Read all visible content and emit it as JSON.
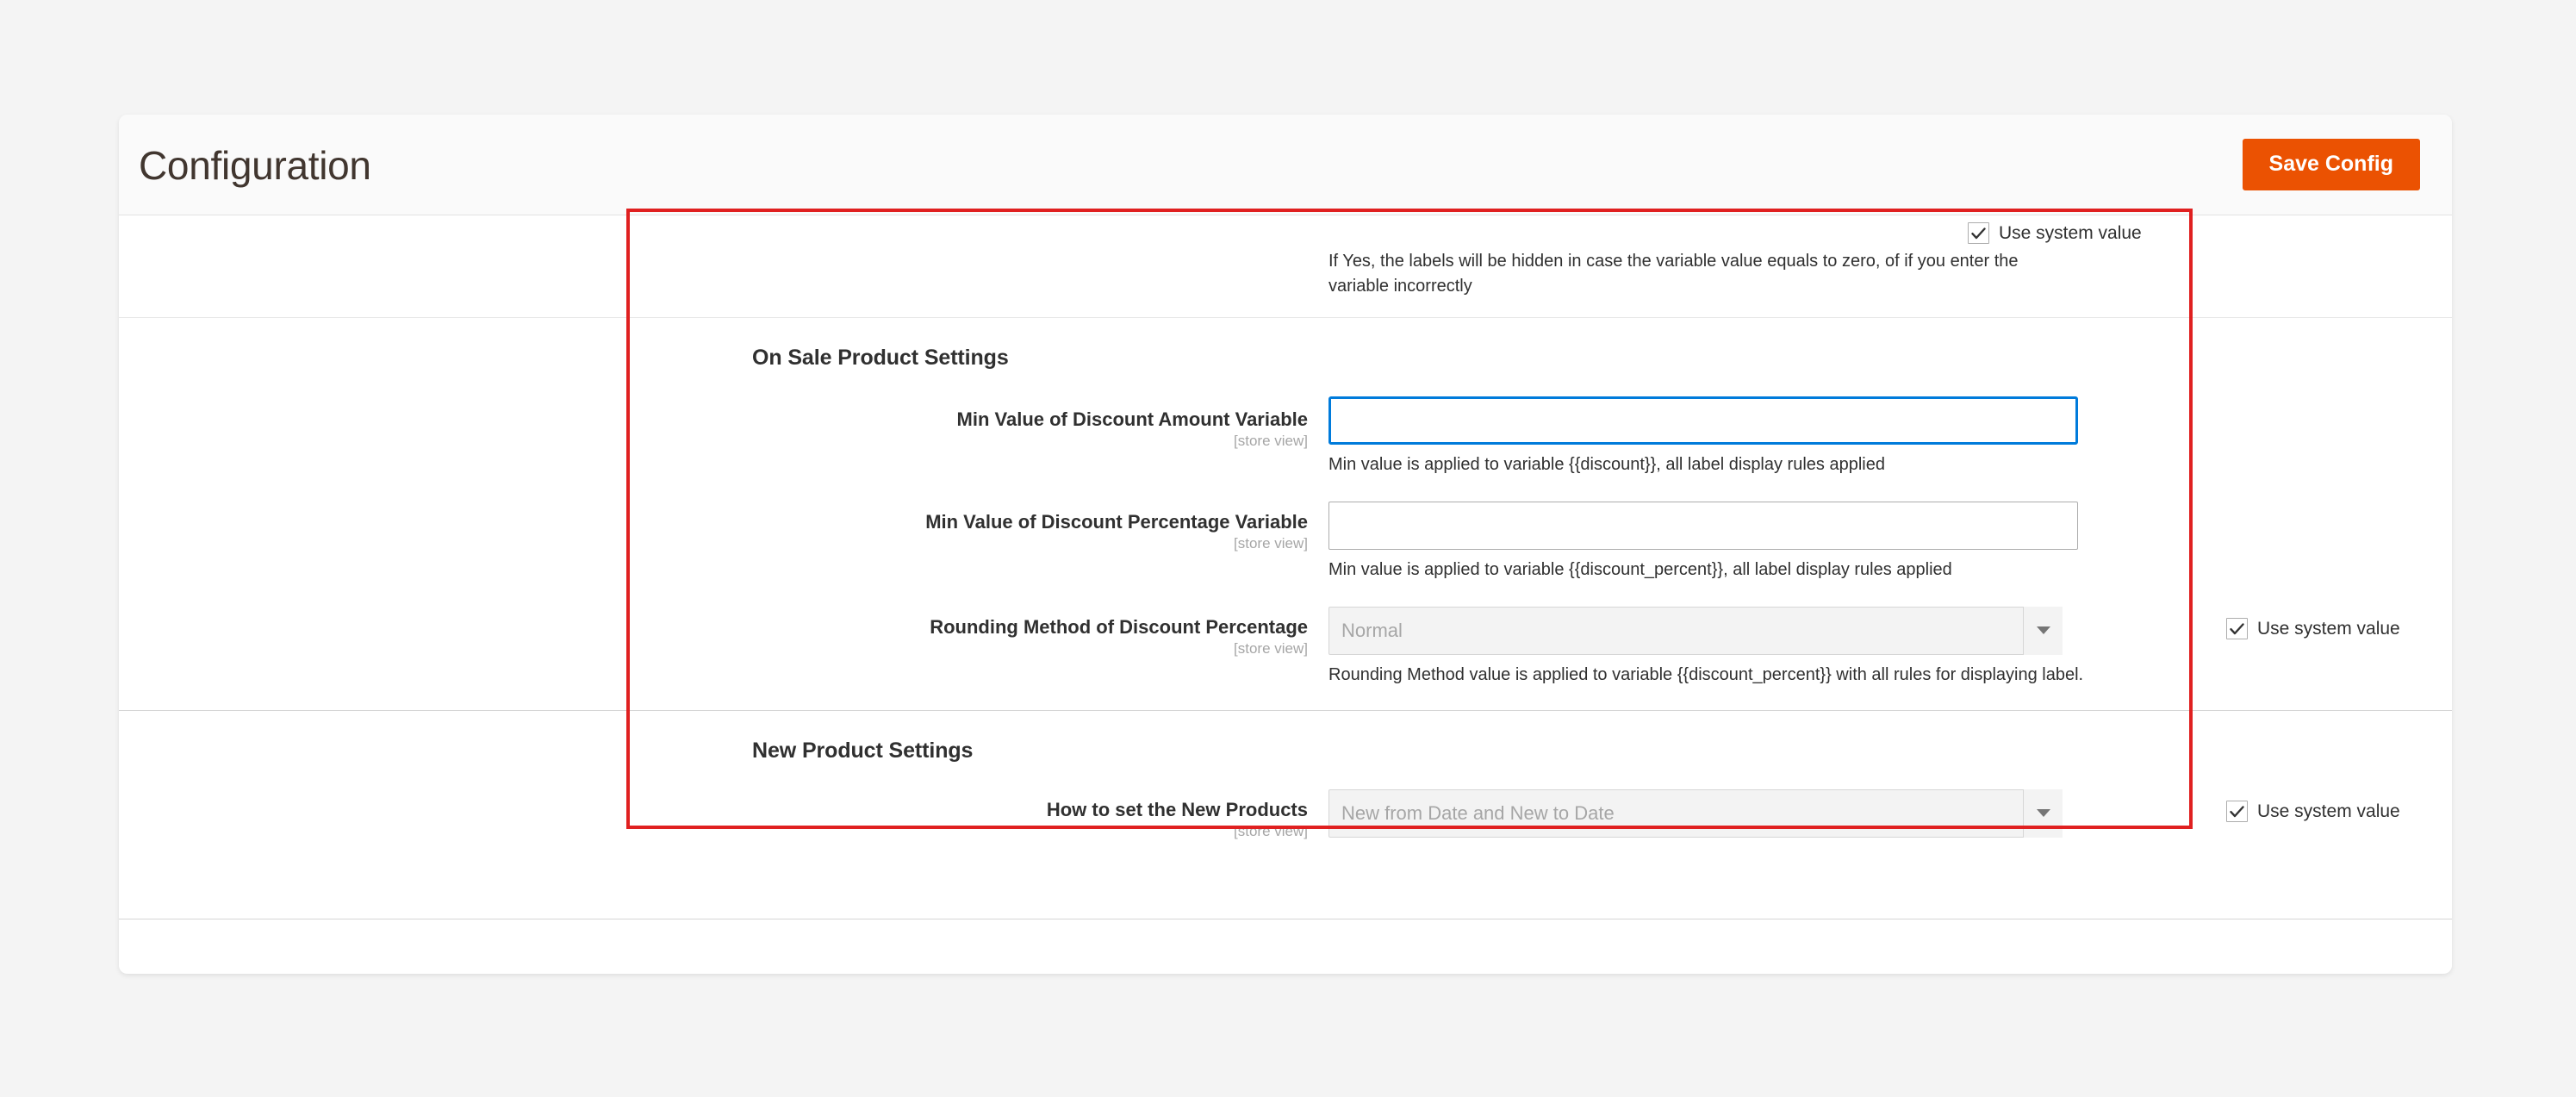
{
  "header": {
    "title": "Configuration",
    "save_label": "Save Config"
  },
  "use_system_value_label": "Use system value",
  "top_fragment": {
    "comment": "If Yes, the labels will be hidden in case the variable value equals to zero, of if you enter the variable incorrectly"
  },
  "sections": [
    {
      "legend": "On Sale Product Settings",
      "fields": [
        {
          "label": "Min Value of Discount Amount Variable",
          "scope": "[store view]",
          "type": "text",
          "value": "",
          "focused": true,
          "comment": "Min value is applied to variable {{discount}}, all label display rules applied",
          "use_system_value": false
        },
        {
          "label": "Min Value of Discount Percentage Variable",
          "scope": "[store view]",
          "type": "text",
          "value": "",
          "focused": false,
          "comment": "Min value is applied to variable {{discount_percent}}, all label display rules applied",
          "use_system_value": false
        },
        {
          "label": "Rounding Method of Discount Percentage",
          "scope": "[store view]",
          "type": "select",
          "value": "Normal",
          "comment": "Rounding Method value is applied to variable {{discount_percent}} with all rules for displaying label.",
          "use_system_value": true
        }
      ]
    },
    {
      "legend": "New Product Settings",
      "fields": [
        {
          "label": "How to set the New Products",
          "scope": "[store view]",
          "type": "select",
          "value": "New from Date and New to Date",
          "comment": "",
          "use_system_value": true
        }
      ]
    }
  ],
  "colors": {
    "accent_orange": "#eb5202",
    "focus_blue": "#007bdb",
    "annotation_red": "#e02020"
  }
}
